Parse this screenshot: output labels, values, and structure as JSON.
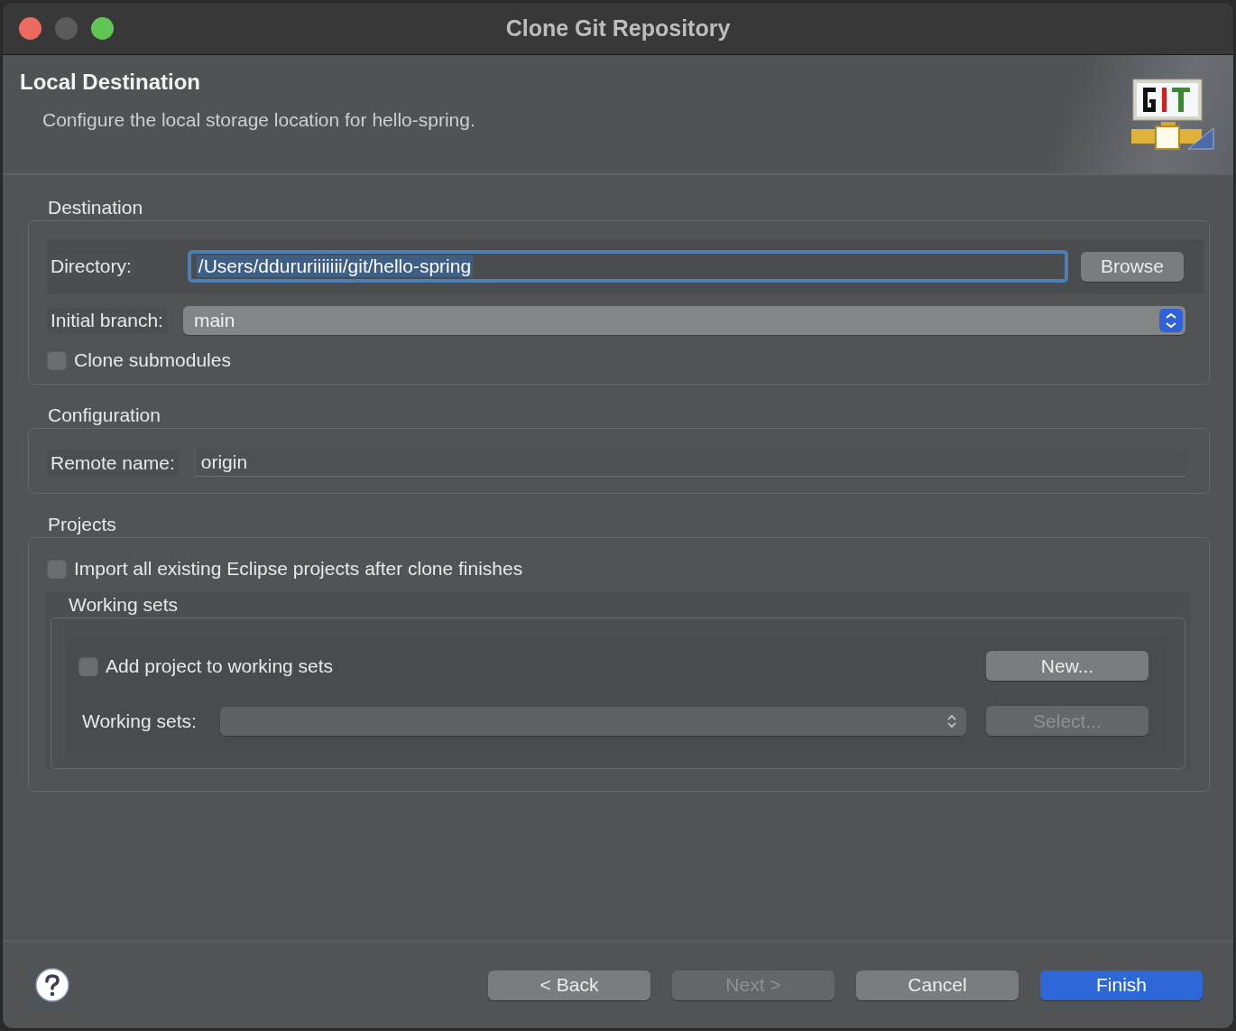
{
  "window": {
    "title": "Clone Git Repository"
  },
  "header": {
    "title": "Local Destination",
    "description": "Configure the local storage location for hello-spring."
  },
  "destination": {
    "heading": "Destination",
    "directory_label": "Directory:",
    "directory_value": "/Users/ddururiiiiiii/git/hello-spring",
    "browse_button": "Browse",
    "branch_label": "Initial branch:",
    "branch_value": "main",
    "clone_submodules": {
      "label": "Clone submodules",
      "checked": false
    }
  },
  "configuration": {
    "heading": "Configuration",
    "remote_label": "Remote name:",
    "remote_value": "origin"
  },
  "projects": {
    "heading": "Projects",
    "import_all": {
      "label": "Import all existing Eclipse projects after clone finishes",
      "checked": false
    },
    "working_sets": {
      "heading": "Working sets",
      "add_to_sets": {
        "label": "Add project to working sets",
        "checked": false
      },
      "new_button": "New...",
      "sets_label": "Working sets:",
      "sets_disabled": true,
      "select_button": {
        "label": "Select...",
        "disabled": true
      }
    }
  },
  "buttons": [
    {
      "label": "< Back",
      "kind": "normal",
      "disabled": false
    },
    {
      "label": "Next >",
      "kind": "normal",
      "disabled": true
    },
    {
      "label": "Cancel",
      "kind": "normal",
      "disabled": false
    },
    {
      "label": "Finish",
      "kind": "default",
      "disabled": false
    }
  ]
}
